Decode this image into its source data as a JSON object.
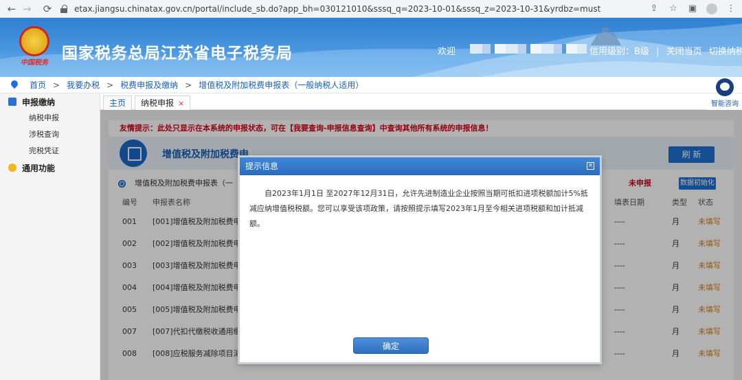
{
  "browser": {
    "url": "etax.jiangsu.chinatax.gov.cn/portal/include_sb.do?app_bh=030121010&sssq_q=2023-10-01&sssq_z=2023-10-31&yrdbz=must"
  },
  "header": {
    "emblem_text": "中国税务",
    "title": "国家税务总局江苏省电子税务局",
    "welcome": "欢迎",
    "credit": "信用级别：B级",
    "divider": "|",
    "close_page": "关闭当页",
    "switch_taxpayer": "切换纳税人"
  },
  "breadcrumb": {
    "items": [
      "首页",
      "我要办税",
      "税费申报及缴纳",
      "增值税及附加税费申报表（一般纳税人适用）"
    ],
    "separator": ">"
  },
  "assistant": {
    "label": "智能咨询"
  },
  "sidebar": {
    "group1": "申报缴纳",
    "items": [
      "纳税申报",
      "涉税查询",
      "完税凭证"
    ],
    "group2": "通用功能"
  },
  "tabs": {
    "home": "主页",
    "active": "纳税申报",
    "close": "×"
  },
  "content": {
    "notice": "友情提示：此处只显示在本系统的申报状态，可在【我要查询-申报信息查询】中查询其他所有系统的申报信息！",
    "banner_title": "增值税及附加税费申",
    "refresh": "刷 新",
    "select_label": "增值税及附加税费申报表（一",
    "status_unfiled": "未申报",
    "init_button": "数据初始化",
    "columns": {
      "no": "编号",
      "name": "申报表名称",
      "date": "填表日期",
      "type": "类型",
      "status": "状态"
    },
    "rows": [
      {
        "no": "001",
        "name": "[001]增值税及附加税费申",
        "date": "----",
        "type": "月",
        "status": "未填写"
      },
      {
        "no": "002",
        "name": "[002]增值税及附加税费申",
        "date": "----",
        "type": "月",
        "status": "未填写"
      },
      {
        "no": "003",
        "name": "[003]增值税及附加税费申",
        "date": "----",
        "type": "月",
        "status": "未填写"
      },
      {
        "no": "004",
        "name": "[004]增值税及附加税费申",
        "date": "----",
        "type": "月",
        "status": "未填写"
      },
      {
        "no": "005",
        "name": "[005]增值税及附加税费申",
        "date": "----",
        "type": "月",
        "status": "未填写"
      },
      {
        "no": "007",
        "name": "[007]代扣代缴税收通用缴",
        "date": "----",
        "type": "月",
        "status": "未填写"
      },
      {
        "no": "008",
        "name": "[008]应税服务减除项目清",
        "date": "----",
        "type": "月",
        "status": "未填写"
      }
    ]
  },
  "modal": {
    "title": "提示信息",
    "close": "×",
    "body": "自2023年1月1日 至2027年12月31日，允许先进制造业企业按照当期可抵扣进项税额加计5%抵减应纳增值税税额。您可以享受该项政策，请按照提示填写2023年1月至今相关进项税额和加计抵减额。",
    "ok": "确定"
  }
}
